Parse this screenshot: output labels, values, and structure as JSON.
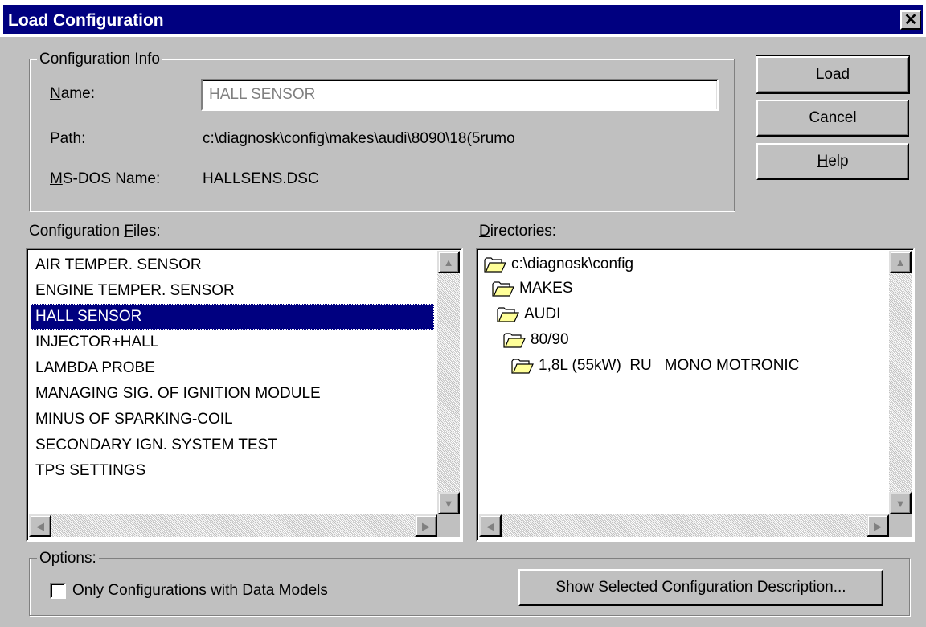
{
  "window": {
    "title": "Load Configuration",
    "close_glyph": "✕"
  },
  "config_info": {
    "legend": "Configuration Info",
    "name_label_accel": "N",
    "name_label_rest": "ame:",
    "name_value": "HALL SENSOR",
    "path_label": "Path:",
    "path_value": "c:\\diagnosk\\config\\makes\\audi\\8090\\18(5rumo",
    "msdos_label_accel": "M",
    "msdos_label_rest": "S-DOS Name:",
    "msdos_value": "HALLSENS.DSC"
  },
  "buttons": {
    "load": "Load",
    "cancel": "Cancel",
    "help_accel": "H",
    "help_rest": "elp",
    "show_description": "Show Selected Configuration Description..."
  },
  "config_files": {
    "label_pre": "Configuration ",
    "label_accel": "F",
    "label_post": "iles:",
    "items": [
      "AIR TEMPER. SENSOR",
      "ENGINE TEMPER. SENSOR",
      "HALL SENSOR",
      "INJECTOR+HALL",
      "LAMBDA PROBE",
      "MANAGING SIG. OF IGNITION MODULE",
      "MINUS OF SPARKING-COIL",
      "SECONDARY IGN. SYSTEM TEST",
      "TPS SETTINGS"
    ],
    "selected_index": 2
  },
  "directories": {
    "label_accel": "D",
    "label_rest": "irectories:",
    "items": [
      {
        "label": "c:\\diagnosk\\config",
        "icon": "open-folder-icon"
      },
      {
        "label": "MAKES",
        "icon": "open-folder-icon"
      },
      {
        "label": "AUDI",
        "icon": "open-folder-icon"
      },
      {
        "label": "80/90",
        "icon": "open-folder-icon"
      },
      {
        "label": "1,8L (55kW)  RU   MONO MOTRONIC",
        "icon": "open-folder-icon"
      }
    ]
  },
  "options": {
    "legend": "Options:",
    "checkbox_pre": "Only Configurations with Data ",
    "checkbox_accel": "M",
    "checkbox_post": "odels",
    "checkbox_checked": false
  },
  "colors": {
    "face": "#c0c0c0",
    "title_bar": "#000080",
    "selection": "#000080",
    "disabled_text": "#808080",
    "folder": "#ffff99"
  }
}
